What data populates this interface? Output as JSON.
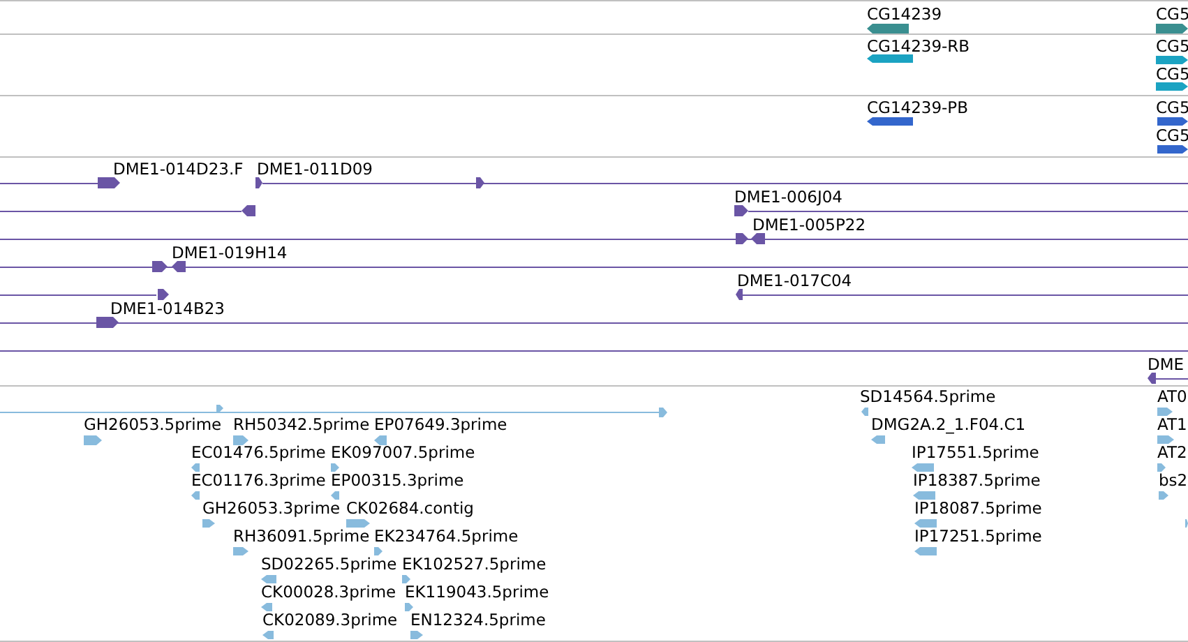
{
  "tracks": [
    {
      "kind": "gene",
      "color": "#3a8f90",
      "features": [
        {
          "label": "CG14239",
          "reverse": true
        },
        {
          "label": "CG5",
          "reverse": false
        }
      ]
    },
    {
      "kind": "transcript",
      "color": "#1ba3c2",
      "features": [
        {
          "label": "CG14239-RB",
          "reverse": true
        },
        {
          "label": "CG5",
          "reverse": false
        },
        {
          "label": "CG5",
          "reverse": false
        }
      ]
    },
    {
      "kind": "protein",
      "color": "#3366cc",
      "features": [
        {
          "label": "CG14239-PB",
          "reverse": true
        },
        {
          "label": "CG5",
          "reverse": false
        },
        {
          "label": "CG5",
          "reverse": false
        }
      ]
    },
    {
      "kind": "clone",
      "color": "#6a55a5",
      "features": [
        {
          "label": "DME1-014D23.F",
          "reverse": false
        },
        {
          "label": "DME1-011D09",
          "reverse": false
        },
        {
          "label": "DME1-006J04",
          "reverse": false
        },
        {
          "label": "DME1-005P22",
          "reverse": true
        },
        {
          "label": "DME1-019H14",
          "reverse": true
        },
        {
          "label": "DME1-017C04",
          "reverse": true
        },
        {
          "label": "DME1-014B23",
          "reverse": false
        },
        {
          "label": "DME",
          "reverse": true
        }
      ]
    },
    {
      "kind": "est",
      "color": "#88bbdd",
      "features": [
        {
          "label": "GH26053.5prime",
          "reverse": false
        },
        {
          "label": "RH50342.5prime",
          "reverse": false
        },
        {
          "label": "EP07649.3prime",
          "reverse": true
        },
        {
          "label": "EC01476.5prime",
          "reverse": true
        },
        {
          "label": "EK097007.5prime",
          "reverse": false
        },
        {
          "label": "EC01176.3prime",
          "reverse": true
        },
        {
          "label": "EP00315.3prime",
          "reverse": true
        },
        {
          "label": "GH26053.3prime",
          "reverse": false
        },
        {
          "label": "CK02684.contig",
          "reverse": false
        },
        {
          "label": "RH36091.5prime",
          "reverse": false
        },
        {
          "label": "EK234764.5prime",
          "reverse": false
        },
        {
          "label": "SD02265.5prime",
          "reverse": true
        },
        {
          "label": "EK102527.5prime",
          "reverse": false
        },
        {
          "label": "CK00028.3prime",
          "reverse": true
        },
        {
          "label": "EK119043.5prime",
          "reverse": false
        },
        {
          "label": "CK02089.3prime",
          "reverse": true
        },
        {
          "label": "EN12324.5prime",
          "reverse": false
        },
        {
          "label": "SD14564.5prime",
          "reverse": true
        },
        {
          "label": "DMG2A.2_1.F04.C1",
          "reverse": true
        },
        {
          "label": "IP17551.5prime",
          "reverse": true
        },
        {
          "label": "IP18387.5prime",
          "reverse": true
        },
        {
          "label": "IP18087.5prime",
          "reverse": true
        },
        {
          "label": "IP17251.5prime",
          "reverse": true
        },
        {
          "label": "AT0",
          "reverse": false
        },
        {
          "label": "AT1",
          "reverse": false
        },
        {
          "label": "AT2",
          "reverse": false
        },
        {
          "label": "bs2",
          "reverse": false
        }
      ]
    }
  ]
}
